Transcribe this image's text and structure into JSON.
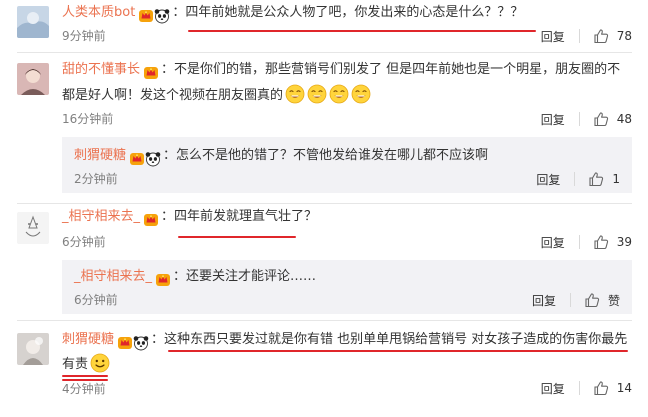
{
  "comments": [
    {
      "user": "人类本质bot",
      "text": "四年前她就是公众人物了吧，你发出来的心态是什么？？？",
      "time": "9分钟前",
      "reply": "回复",
      "likes": "78"
    },
    {
      "user": "甜的不懂事长",
      "text_line1": "不是你们的错，那些营销号们别发了 但是四年前她也是一个明星，朋友圈的不",
      "text_line2": "都是好人啊！发这个视频在朋友圈真的",
      "time": "16分钟前",
      "reply": "回复",
      "likes": "48",
      "emoji_count": 4,
      "sub": {
        "user": "刺猬硬糖",
        "text": "怎么不是他的错了？不管他发给谁发在哪儿都不应该啊",
        "time": "2分钟前",
        "reply": "回复",
        "likes": "1"
      }
    },
    {
      "user": "_相守相来去_",
      "text": "四年前发就理直气壮了？",
      "time": "6分钟前",
      "reply": "回复",
      "likes": "39",
      "sub": {
        "user": "_相守相来去_",
        "text": "还要关注才能评论……",
        "time": "6分钟前",
        "reply": "回复",
        "likes": "赞"
      }
    },
    {
      "user": "刺猬硬糖",
      "text_line1": "这种东西只要发过就是你有错 也别单单甩锅给营销号 对女孩子造成的伤害你最先",
      "text_line2": "有责",
      "time": "4分钟前",
      "reply": "回复",
      "likes": "14"
    }
  ],
  "colon": "：",
  "colors": {
    "username": "#eb7350",
    "underline": "#e0262b",
    "sub_panel": "#f2f2f5",
    "divider": "#e6e6e6"
  },
  "icons": [
    "crown-badge-icon",
    "panda-icon",
    "thumbs-up-icon",
    "grin-emoji-icon",
    "smile-emoji-icon"
  ]
}
